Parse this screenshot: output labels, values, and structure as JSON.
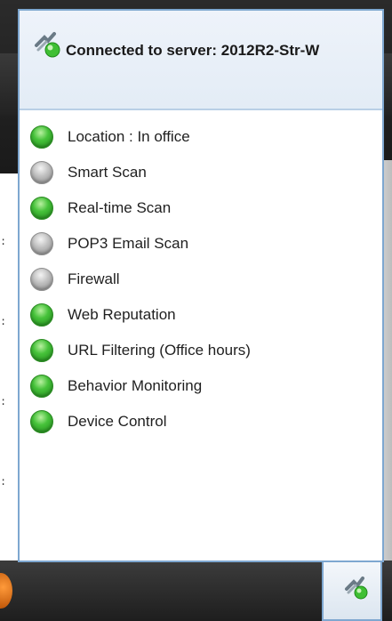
{
  "header": {
    "title": "Connected to server: 2012R2-Str-W",
    "icon": "server-connected-icon"
  },
  "status_items": [
    {
      "label": "Location : In office",
      "status": "green"
    },
    {
      "label": "Smart Scan",
      "status": "gray"
    },
    {
      "label": "Real-time Scan",
      "status": "green"
    },
    {
      "label": "POP3 Email Scan",
      "status": "gray"
    },
    {
      "label": "Firewall",
      "status": "gray"
    },
    {
      "label": "Web Reputation",
      "status": "green"
    },
    {
      "label": "URL Filtering (Office hours)",
      "status": "green"
    },
    {
      "label": "Behavior Monitoring",
      "status": "green"
    },
    {
      "label": "Device Control",
      "status": "green"
    }
  ],
  "tray": {
    "icon": "agent-tray-icon"
  },
  "colors": {
    "status_on": "#46c23a",
    "status_off": "#bdbdbd",
    "popup_border": "#7ea7d0",
    "header_bg": "#e3ecf6"
  }
}
